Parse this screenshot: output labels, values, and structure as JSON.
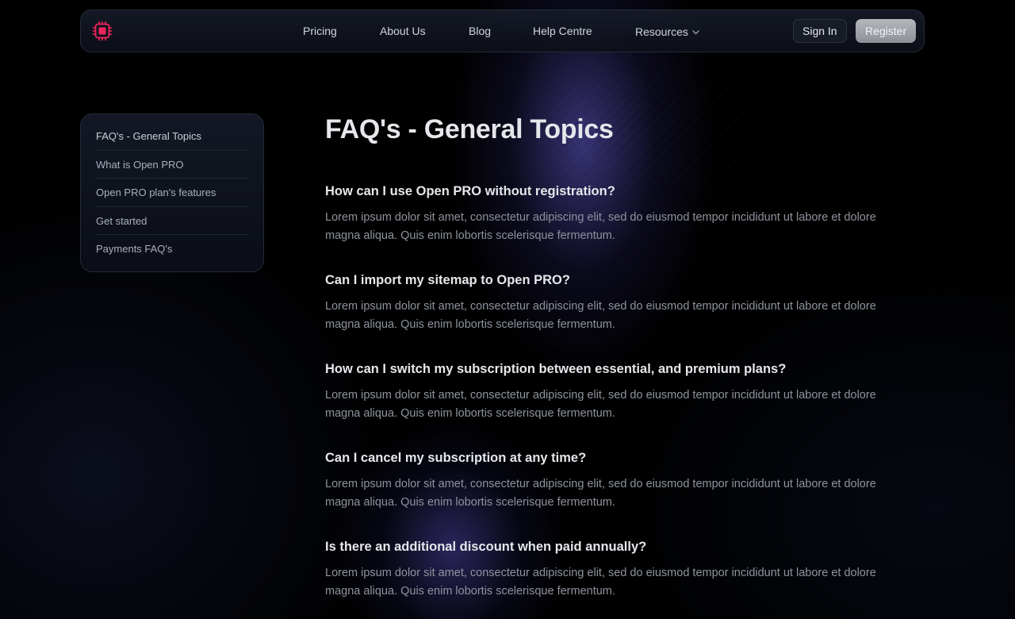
{
  "colors": {
    "background": "#000000",
    "logo_accent": "#f0245d",
    "heading": "#e5e7eb",
    "body_text": "#8e939d",
    "glow": "#635bd2"
  },
  "header": {
    "logo_icon": "chip-icon",
    "nav": [
      {
        "label": "Pricing"
      },
      {
        "label": "About Us"
      },
      {
        "label": "Blog"
      },
      {
        "label": "Help Centre"
      },
      {
        "label": "Resources",
        "icon": "chevron-down-icon"
      }
    ],
    "signin_label": "Sign In",
    "register_label": "Register"
  },
  "sidebar": {
    "items": [
      {
        "label": "FAQ's - General Topics"
      },
      {
        "label": "What is Open PRO"
      },
      {
        "label": "Open PRO plan's features"
      },
      {
        "label": "Get started"
      },
      {
        "label": "Payments FAQ's"
      }
    ]
  },
  "main": {
    "title": "FAQ's - General Topics",
    "faqs": [
      {
        "question": "How can I use Open PRO without registration?",
        "answer": "Lorem ipsum dolor sit amet, consectetur adipiscing elit, sed do eiusmod tempor incididunt ut labore et dolore magna aliqua. Quis enim lobortis scelerisque fermentum."
      },
      {
        "question": "Can I import my sitemap to Open PRO?",
        "answer": "Lorem ipsum dolor sit amet, consectetur adipiscing elit, sed do eiusmod tempor incididunt ut labore et dolore magna aliqua. Quis enim lobortis scelerisque fermentum."
      },
      {
        "question": "How can I switch my subscription between essential, and premium plans?",
        "answer": "Lorem ipsum dolor sit amet, consectetur adipiscing elit, sed do eiusmod tempor incididunt ut labore et dolore magna aliqua. Quis enim lobortis scelerisque fermentum."
      },
      {
        "question": "Can I cancel my subscription at any time?",
        "answer": "Lorem ipsum dolor sit amet, consectetur adipiscing elit, sed do eiusmod tempor incididunt ut labore et dolore magna aliqua. Quis enim lobortis scelerisque fermentum."
      },
      {
        "question": "Is there an additional discount when paid annually?",
        "answer": "Lorem ipsum dolor sit amet, consectetur adipiscing elit, sed do eiusmod tempor incididunt ut labore et dolore magna aliqua. Quis enim lobortis scelerisque fermentum."
      }
    ]
  }
}
